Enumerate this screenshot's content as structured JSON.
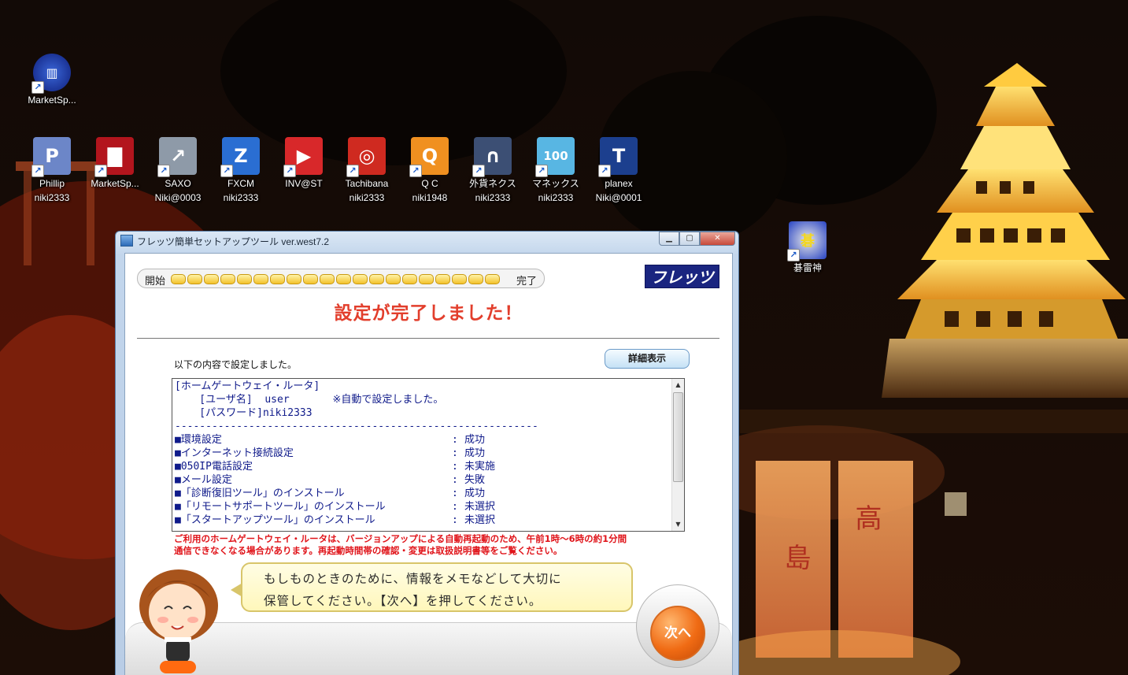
{
  "desktop": {
    "icons_top": [
      {
        "name": "MarketSpeed-1",
        "label": "MarketSp...",
        "sub": "",
        "color": "#1b3fa8",
        "glyph": "▥"
      }
    ],
    "icons_row": [
      {
        "label": "Phillip",
        "sub": "niki2333",
        "color": "#6c86c8",
        "glyph": "P"
      },
      {
        "label": "MarketSp...",
        "sub": "",
        "color": "#b3151d",
        "glyph": "▇"
      },
      {
        "label": "SAXO",
        "sub": "Niki@0003",
        "color": "#8e9aa8",
        "glyph": "↗"
      },
      {
        "label": "FXCM",
        "sub": "niki2333",
        "color": "#2a6ed2",
        "glyph": "Z"
      },
      {
        "label": "INV@ST",
        "sub": "",
        "color": "#d8282a",
        "glyph": "▶"
      },
      {
        "label": "Tachibana",
        "sub": "niki2333",
        "color": "#cf2a20",
        "glyph": "◎"
      },
      {
        "label": "Q C",
        "sub": "niki1948",
        "color": "#f09020",
        "glyph": "Q"
      },
      {
        "label": "外貨ネクス",
        "sub": "niki2333",
        "color": "#3c4f74",
        "glyph": "∩"
      },
      {
        "label": "マネックス",
        "sub": "niki2333",
        "color": "#58b6e3",
        "glyph": "100"
      },
      {
        "label": "planex",
        "sub": "Niki@0001",
        "color": "#1c3f8e",
        "glyph": "T"
      }
    ],
    "icon_right": {
      "label": "碁雷神",
      "sub": "",
      "color": "#2743c4",
      "glyph": "碁"
    }
  },
  "window": {
    "title": "フレッツ簡単セットアップツール ver.west7.2",
    "minimize_glyph": "▁",
    "maximize_glyph": "▢",
    "close_glyph": "✕",
    "progress": {
      "start_label": "開始",
      "end_label": "完了",
      "segments": 20,
      "completed": 20
    },
    "brand": "フレッツ",
    "headline": "設定が完了しました！",
    "intro": "以下の内容で設定しました。",
    "detail_button": "詳細表示",
    "results": {
      "router_header": "[ホームゲートウェイ・ルータ]",
      "user_line": "    [ユーザ名]  user       ※自動で設定しました。",
      "password_line": "    [パスワード]niki2333",
      "rule": "-----------------------------------------------------------",
      "items": [
        {
          "name": "■環境設定",
          "status": "成功"
        },
        {
          "name": "■インターネット接続設定",
          "status": "成功"
        },
        {
          "name": "■050IP電話設定",
          "status": "未実施"
        },
        {
          "name": "■メール設定",
          "status": "失敗"
        },
        {
          "name": "■「診断復旧ツール」のインストール",
          "status": "成功"
        },
        {
          "name": "■「リモートサポートツール」のインストール",
          "status": "未選択"
        },
        {
          "name": "■「スタートアップツール」のインストール",
          "status": "未選択"
        }
      ],
      "colon": ":"
    },
    "notice_line1": "ご利用のホームゲートウェイ・ルータは、バージョンアップによる自動再起動のため、午前1時～6時の約1分間",
    "notice_line2": "通信できなくなる場合があります。再起動時間帯の確認・変更は取扱説明書等をご覧ください。",
    "bubble_line1": "もしものときのために、情報をメモなどして大切に",
    "bubble_line2": "保管してください。【次へ】を押してください。",
    "next_button": "次へ"
  }
}
